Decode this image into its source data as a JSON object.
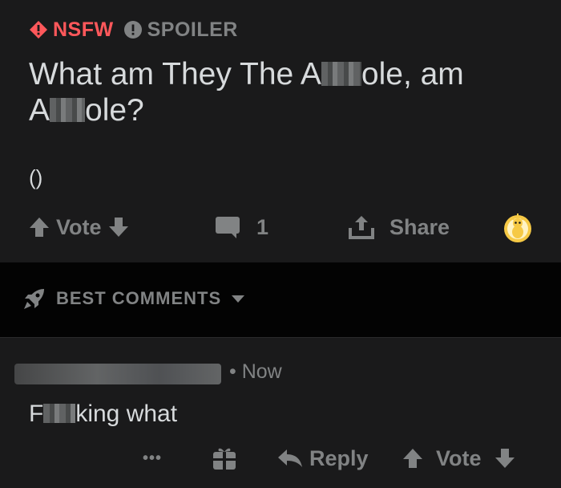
{
  "post": {
    "tags": {
      "nsfw": "NSFW",
      "spoiler": "SPOILER"
    },
    "title_part1": "What am They The A",
    "title_part2": "ole, am",
    "title_part3": "A",
    "title_part4": "ole?",
    "body": "()",
    "actions": {
      "vote_label": "Vote",
      "comment_count": "1",
      "share_label": "Share"
    }
  },
  "sort": {
    "label": "BEST COMMENTS"
  },
  "comment": {
    "timestamp": "• Now",
    "text_part1": "F",
    "text_part2": "king what",
    "actions": {
      "more_label": "•••",
      "reply_label": "Reply",
      "vote_label": "Vote"
    }
  },
  "colors": {
    "nsfw": "#ff585b",
    "muted": "#818384",
    "text": "#d7dadc",
    "bg": "#1a1a1b",
    "band": "#030303",
    "award": "#f6c945"
  }
}
